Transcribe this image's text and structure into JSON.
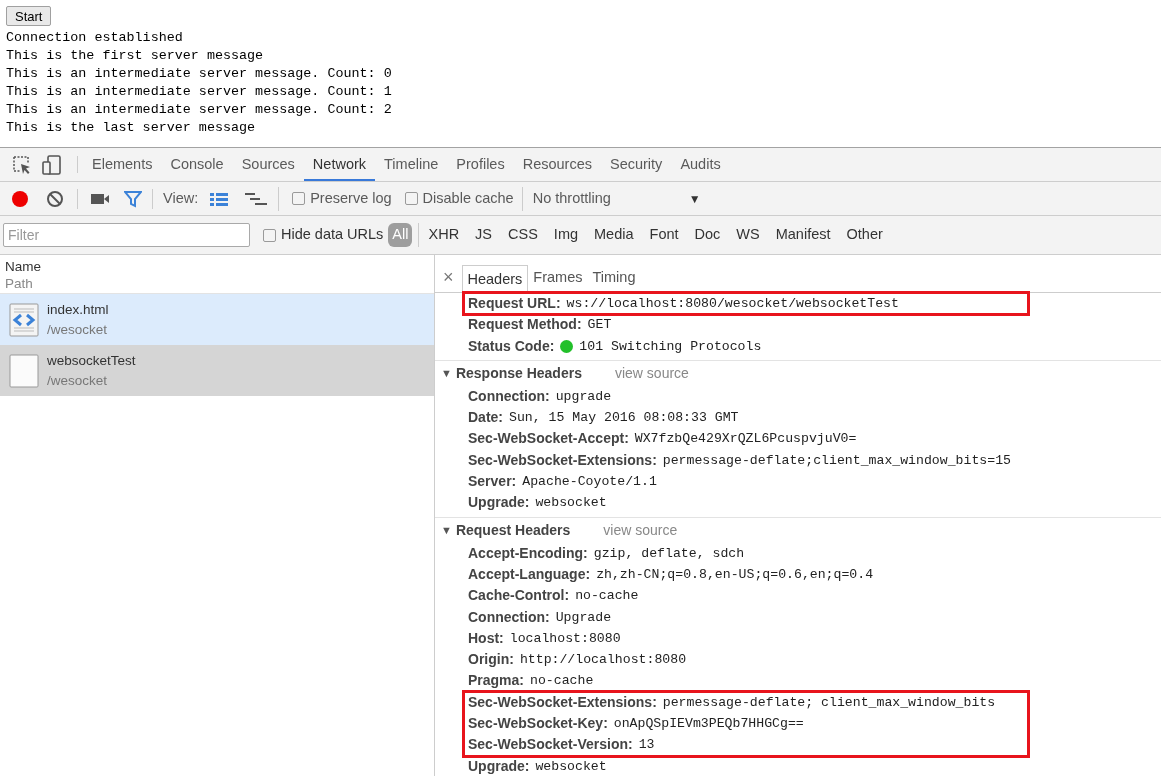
{
  "page": {
    "button": "Start",
    "lines": [
      "Connection established",
      "This is the first server message",
      "This is an intermediate server message. Count: 0",
      "This is an intermediate server message. Count: 1",
      "This is an intermediate server message. Count: 2",
      "This is the last server message"
    ]
  },
  "devtools_tabs": [
    {
      "label": "Elements",
      "selected": false
    },
    {
      "label": "Console",
      "selected": false
    },
    {
      "label": "Sources",
      "selected": false
    },
    {
      "label": "Network",
      "selected": true
    },
    {
      "label": "Timeline",
      "selected": false
    },
    {
      "label": "Profiles",
      "selected": false
    },
    {
      "label": "Resources",
      "selected": false
    },
    {
      "label": "Security",
      "selected": false
    },
    {
      "label": "Audits",
      "selected": false
    }
  ],
  "toolbar": {
    "recording": true,
    "filter_on": true,
    "view_label": "View:",
    "large_rows": true,
    "preserve_log": {
      "label": "Preserve log",
      "checked": false
    },
    "disable_cache": {
      "label": "Disable cache",
      "checked": false
    },
    "throttling": "No throttling",
    "dropdown_arrow": "▼"
  },
  "filter_bar": {
    "placeholder": "Filter",
    "hide_data_urls": {
      "label": "Hide data URLs",
      "checked": false
    },
    "types": [
      {
        "label": "All",
        "selected": true
      },
      {
        "label": "XHR",
        "selected": false
      },
      {
        "label": "JS",
        "selected": false
      },
      {
        "label": "CSS",
        "selected": false
      },
      {
        "label": "Img",
        "selected": false
      },
      {
        "label": "Media",
        "selected": false
      },
      {
        "label": "Font",
        "selected": false
      },
      {
        "label": "Doc",
        "selected": false
      },
      {
        "label": "WS",
        "selected": false
      },
      {
        "label": "Manifest",
        "selected": false
      },
      {
        "label": "Other",
        "selected": false
      }
    ]
  },
  "requests": {
    "columns": [
      "Name",
      "Path"
    ],
    "rows": [
      {
        "name": "index.html",
        "path": "/wesocket",
        "kind": "html",
        "hovered": true,
        "selected": false
      },
      {
        "name": "websocketTest",
        "path": "/wesocket",
        "kind": "plain",
        "hovered": false,
        "selected": true
      }
    ]
  },
  "details": {
    "close": "×",
    "tabs": [
      {
        "label": "Headers",
        "selected": true
      },
      {
        "label": "Frames",
        "selected": false
      },
      {
        "label": "Timing",
        "selected": false
      }
    ],
    "general": [
      {
        "highlighted": true,
        "rows": [
          {
            "name": "Request URL:",
            "value": "ws://localhost:8080/wesocket/websocketTest"
          }
        ]
      },
      {
        "highlighted": false,
        "rows": [
          {
            "name": "Request Method:",
            "value": "GET"
          },
          {
            "name": "Status Code:",
            "value": "101 Switching Protocols",
            "color": "#22c02a"
          }
        ]
      }
    ],
    "sections": [
      {
        "title": "Response Headers",
        "toggle": "▼",
        "link": "view source",
        "groups": [
          {
            "highlighted": false,
            "rows": [
              {
                "name": "Connection:",
                "value": "upgrade"
              },
              {
                "name": "Date:",
                "value": "Sun, 15 May 2016 08:08:33 GMT"
              },
              {
                "name": "Sec-WebSocket-Accept:",
                "value": "WX7fzbQe429XrQZL6PcuspvjuV0="
              },
              {
                "name": "Sec-WebSocket-Extensions:",
                "value": "permessage-deflate;client_max_window_bits=15"
              },
              {
                "name": "Server:",
                "value": "Apache-Coyote/1.1"
              },
              {
                "name": "Upgrade:",
                "value": "websocket"
              }
            ]
          }
        ]
      },
      {
        "title": "Request Headers",
        "toggle": "▼",
        "link": "view source",
        "groups": [
          {
            "highlighted": false,
            "rows": [
              {
                "name": "Accept-Encoding:",
                "value": "gzip, deflate, sdch"
              },
              {
                "name": "Accept-Language:",
                "value": "zh,zh-CN;q=0.8,en-US;q=0.6,en;q=0.4"
              },
              {
                "name": "Cache-Control:",
                "value": "no-cache"
              },
              {
                "name": "Connection:",
                "value": "Upgrade"
              },
              {
                "name": "Host:",
                "value": "localhost:8080"
              },
              {
                "name": "Origin:",
                "value": "http://localhost:8080"
              },
              {
                "name": "Pragma:",
                "value": "no-cache"
              }
            ]
          },
          {
            "highlighted": true,
            "rows": [
              {
                "name": "Sec-WebSocket-Extensions:",
                "value": "permessage-deflate; client_max_window_bits"
              },
              {
                "name": "Sec-WebSocket-Key:",
                "value": "onApQSpIEVm3PEQb7HHGCg=="
              },
              {
                "name": "Sec-WebSocket-Version:",
                "value": "13"
              }
            ]
          },
          {
            "highlighted": false,
            "rows": [
              {
                "name": "Upgrade:",
                "value": "websocket"
              }
            ]
          }
        ]
      }
    ]
  }
}
